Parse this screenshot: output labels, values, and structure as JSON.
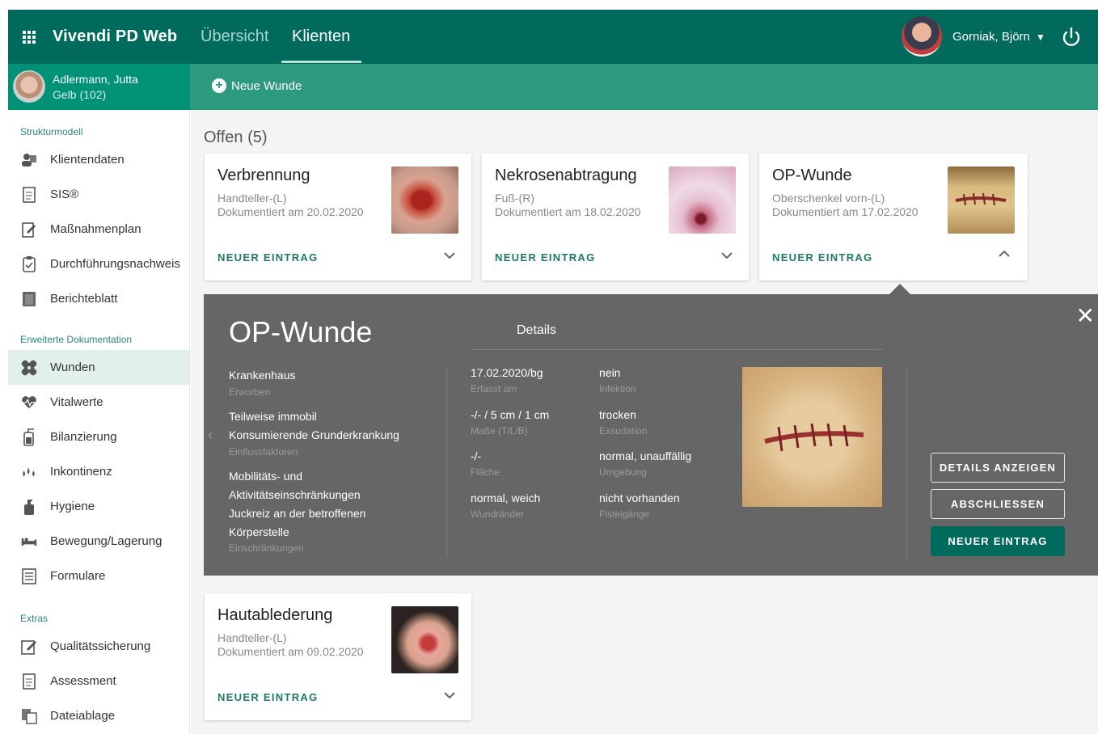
{
  "app": {
    "title": "Vivendi PD Web"
  },
  "nav": {
    "tabs": [
      {
        "label": "Übersicht"
      },
      {
        "label": "Klienten"
      }
    ]
  },
  "user": {
    "name": "Gorniak, Björn"
  },
  "patient": {
    "name": "Adlermann, Jutta",
    "group": "Gelb (102)"
  },
  "actionbar": {
    "new_wound": "Neue Wunde"
  },
  "sidebar": {
    "sections": [
      {
        "label": "Strukturmodell",
        "items": [
          {
            "label": "Klientendaten",
            "icon": "client-data-icon"
          },
          {
            "label": "SIS®",
            "icon": "document-icon"
          },
          {
            "label": "Maßnahmenplan",
            "icon": "edit-plan-icon"
          },
          {
            "label": "Durchführungsnachweis",
            "icon": "checklist-icon"
          },
          {
            "label": "Berichteblatt",
            "icon": "report-icon"
          }
        ]
      },
      {
        "label": "Erweiterte Dokumentation",
        "items": [
          {
            "label": "Wunden",
            "icon": "bandage-icon"
          },
          {
            "label": "Vitalwerte",
            "icon": "heart-rate-icon"
          },
          {
            "label": "Bilanzierung",
            "icon": "balance-icon"
          },
          {
            "label": "Inkontinenz",
            "icon": "drops-icon"
          },
          {
            "label": "Hygiene",
            "icon": "hygiene-icon"
          },
          {
            "label": "Bewegung/Lagerung",
            "icon": "bed-icon"
          },
          {
            "label": "Formulare",
            "icon": "form-icon"
          }
        ]
      },
      {
        "label": "Extras",
        "items": [
          {
            "label": "Qualitätssicherung",
            "icon": "quality-icon"
          },
          {
            "label": "Assessment",
            "icon": "assessment-icon"
          },
          {
            "label": "Dateiablage",
            "icon": "files-icon"
          }
        ]
      }
    ]
  },
  "main": {
    "section_title": "Offen (5)",
    "cards": [
      {
        "title": "Verbrennung",
        "location": "Handteller-(L)",
        "documented": "Dokumentiert am 20.02.2020",
        "action": "NEUER EINTRAG"
      },
      {
        "title": "Nekrosenabtragung",
        "location": "Fuß-(R)",
        "documented": "Dokumentiert am 18.02.2020",
        "action": "NEUER EINTRAG"
      },
      {
        "title": "OP-Wunde",
        "location": "Oberschenkel vorn-(L)",
        "documented": "Dokumentiert am 17.02.2020",
        "action": "NEUER EINTRAG"
      },
      {
        "title": "Hautablederung",
        "location": "Handteller-(L)",
        "documented": "Dokumentiert am 09.02.2020",
        "action": "NEUER EINTRAG"
      }
    ]
  },
  "detail": {
    "title": "OP-Wunde",
    "heading": "Details",
    "left": [
      {
        "value": "Krankenhaus",
        "label": "Erworben"
      },
      {
        "value": "Teilweise immobil\nKonsumierende Grunderkrankung",
        "label": "Einflussfaktoren"
      },
      {
        "value": "Mobilitäts- und\nAktivitätseinschränkungen\nJuckreiz an der betroffenen\nKörperstelle",
        "label": "Einschränkungen"
      }
    ],
    "mid1": [
      {
        "value": "17.02.2020/bg",
        "label": "Erfasst am"
      },
      {
        "value": "-/- / 5 cm / 1 cm",
        "label": "Maße (T/L/B)"
      },
      {
        "value": "-/-",
        "label": "Fläche"
      },
      {
        "value": "normal, weich",
        "label": "Wundränder"
      }
    ],
    "mid2": [
      {
        "value": "nein",
        "label": "Infektion"
      },
      {
        "value": "trocken",
        "label": "Exsudation"
      },
      {
        "value": "normal, unauffällig",
        "label": "Umgebung"
      },
      {
        "value": "nicht vorhanden",
        "label": "Fistelgänge"
      }
    ],
    "buttons": {
      "details": "DETAILS ANZEIGEN",
      "close_wound": "ABSCHLIESSEN",
      "new_entry": "NEUER EINTRAG"
    }
  },
  "colors": {
    "primary": "#006b5d",
    "secondary": "#2d9a7f",
    "panel": "#666666"
  }
}
